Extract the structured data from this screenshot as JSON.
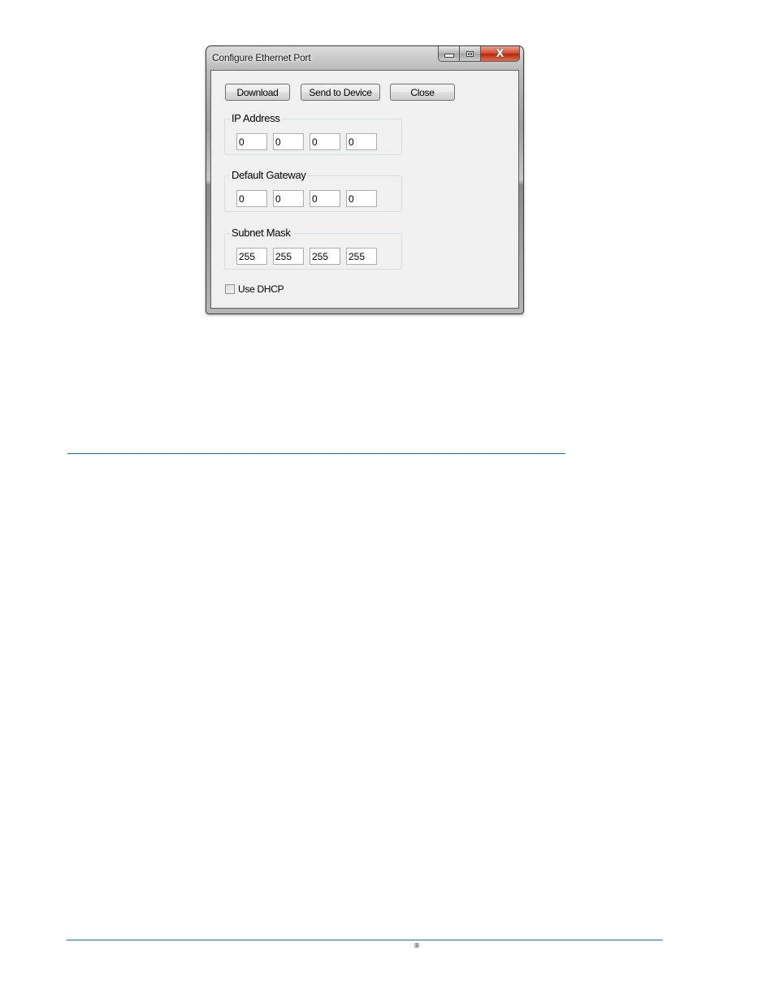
{
  "window": {
    "title": "Configure Ethernet Port",
    "controls": {
      "minimize_icon": "minimize-icon",
      "maximize_icon": "maximize-icon",
      "close_icon": "close-icon",
      "close_glyph": "X"
    }
  },
  "toolbar": {
    "download_label": "Download",
    "send_label": "Send to Device",
    "close_label": "Close"
  },
  "groups": {
    "ip_address": {
      "label": "IP Address",
      "octets": [
        "0",
        "0",
        "0",
        "0"
      ]
    },
    "default_gateway": {
      "label": "Default Gateway",
      "octets": [
        "0",
        "0",
        "0",
        "0"
      ]
    },
    "subnet_mask": {
      "label": "Subnet Mask",
      "octets": [
        "255",
        "255",
        "255",
        "255"
      ]
    }
  },
  "dhcp": {
    "label": "Use DHCP",
    "checked": false
  },
  "footer": {
    "registered_mark": "®"
  },
  "colors": {
    "rule": "#1b75bc",
    "close_button": "#c7391a",
    "dialog_bg": "#f0f0f0"
  }
}
